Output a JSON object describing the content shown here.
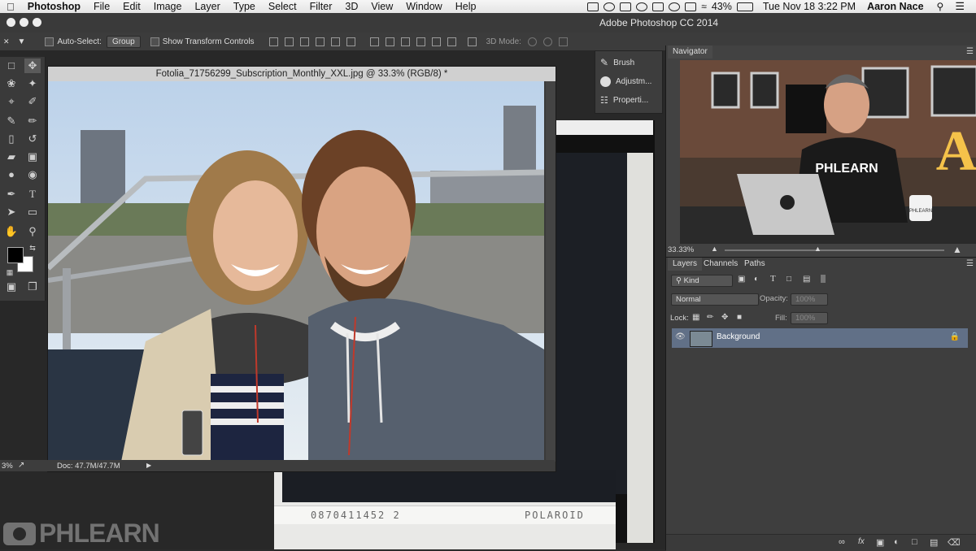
{
  "menubar": {
    "app_name": "Photoshop",
    "items": [
      "File",
      "Edit",
      "Image",
      "Layer",
      "Type",
      "Select",
      "Filter",
      "3D",
      "View",
      "Window",
      "Help"
    ],
    "battery": "43%",
    "clock": "Tue Nov 18  3:22 PM",
    "user": "Aaron Nace"
  },
  "window": {
    "title": "Adobe Photoshop CC 2014"
  },
  "options_bar": {
    "auto_select_label": "Auto-Select:",
    "auto_select_value": "Group",
    "transform_label": "Show Transform Controls",
    "mode_3d_label": "3D Mode:"
  },
  "document": {
    "title": "Fotolia_71756299_Subscription_Monthly_XXL.jpg @ 33.3% (RGB/8) *",
    "zoom": "3%",
    "doc_info": "Doc: 47.7M/47.7M"
  },
  "mini_panel": {
    "items": [
      {
        "label": "Brush",
        "icon": "brush-icon"
      },
      {
        "label": "Adjustm...",
        "icon": "adjustments-icon"
      },
      {
        "label": "Properti...",
        "icon": "properties-icon"
      }
    ]
  },
  "navigator": {
    "tab": "Navigator",
    "zoom": "33.33%",
    "shirt_text": "PHLEARN",
    "mug_text": "PHLEARN",
    "sign_letter": "A"
  },
  "layers": {
    "tabs": [
      "Layers",
      "Channels",
      "Paths"
    ],
    "filter_kind": "Kind",
    "blend_mode": "Normal",
    "opacity_label": "Opacity:",
    "opacity_value": "100%",
    "lock_label": "Lock:",
    "fill_label": "Fill:",
    "fill_value": "100%",
    "rows": [
      {
        "name": "Background"
      }
    ]
  },
  "polaroid": {
    "serial": "0870411452 2",
    "brand": "POLAROID"
  },
  "watermark": {
    "text": "PHLEARN"
  },
  "colors": {
    "foreground": "#000000",
    "background": "#ffffff",
    "layer_selected": "#617087",
    "panel": "#424242"
  }
}
